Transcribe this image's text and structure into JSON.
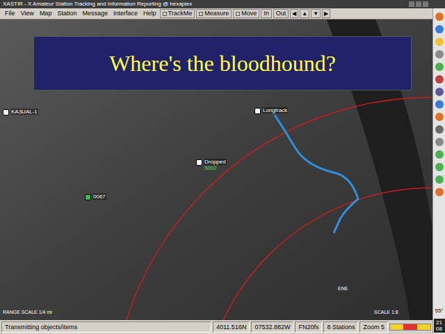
{
  "window": {
    "title": "XASTIR - X Amateur Station Tracking and Information Reporting @ hexaplex"
  },
  "menus": [
    "File",
    "View",
    "Map",
    "Station",
    "Message",
    "Interface",
    "Help"
  ],
  "toggles": [
    {
      "label": "TrackMe",
      "checked": false
    },
    {
      "label": "Measure",
      "checked": false
    },
    {
      "label": "Move",
      "checked": false
    }
  ],
  "buttons": [
    "In",
    "Out"
  ],
  "arrows": [
    "◀",
    "▲",
    "▼",
    "▶"
  ],
  "slide": {
    "title": "Where's the bloodhound?"
  },
  "map": {
    "stations": [
      {
        "label": "Longtrack",
        "sub": ""
      },
      {
        "label": "Dropped",
        "sub": "5002"
      },
      {
        "label": "0067",
        "sub": ""
      },
      {
        "label": "KA3UAL-1",
        "sub": ""
      }
    ],
    "range_scale": "RANGE SCALE 1/4 mi",
    "scale": "SCALE 1:8",
    "marker": "ENE"
  },
  "status_bar": {
    "message": "Transmitting objects/items",
    "lat": "4011.516N",
    "lon": "07532.882W",
    "grid": "FN20fs",
    "stations": "8 Stations",
    "zoom": "Zoom 5"
  },
  "dock": {
    "temperature": "55°",
    "time": [
      "21",
      "08"
    ]
  }
}
